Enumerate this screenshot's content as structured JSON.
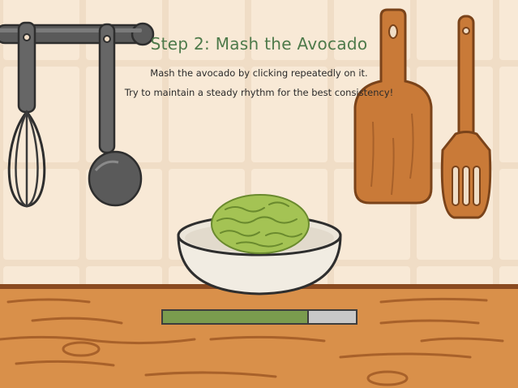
{
  "step_title": "Step 2: Mash the Avocado",
  "instructions": [
    "Mash the avocado by clicking repeatedly on it.",
    "Try to maintain a steady rhythm for the best consistency!"
  ],
  "mash_progress": 0.755,
  "colors": {
    "title": "#4e7a4a",
    "progress_fill": "#7a9c4e",
    "progress_track": "#c8c8c8",
    "avocado": "#a4c354",
    "wall_tile": "#f5e4cf",
    "counter_wood": "#d9904a"
  },
  "icons": [
    "whisk-icon",
    "ladle-icon",
    "cutting-board-icon",
    "wooden-spatula-icon",
    "mixing-bowl-icon",
    "avocado-icon"
  ]
}
